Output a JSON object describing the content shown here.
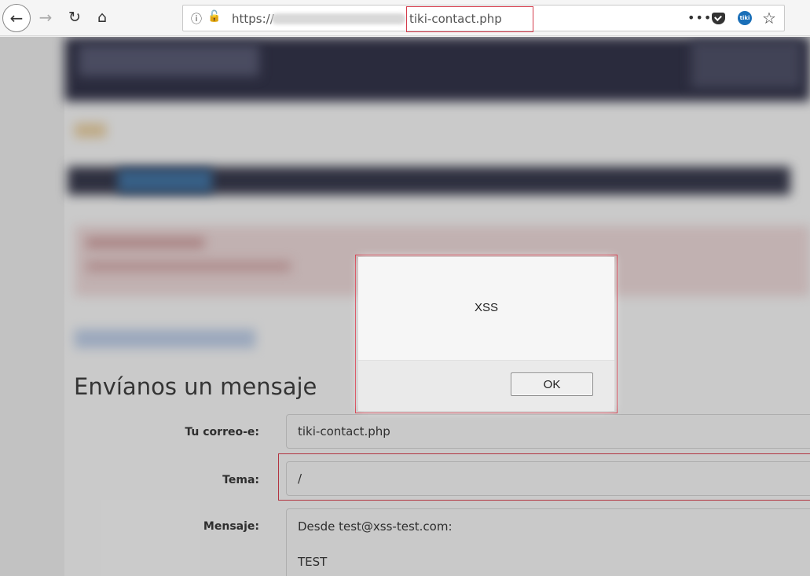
{
  "browser": {
    "back_icon": "arrow-left-icon",
    "forward_icon": "arrow-right-icon",
    "reload_icon": "reload-icon",
    "home_icon": "home-icon",
    "url_scheme": "https://",
    "url_path": "tiki-contact.php",
    "page_actions_label": "•••",
    "star_icon": "☆"
  },
  "form": {
    "title": "Envíanos un mensaje",
    "email_label": "Tu correo-e:",
    "email_value": "tiki-contact.php",
    "subject_label": "Tema:",
    "subject_value": "/",
    "message_label": "Mensaje:",
    "message_line1": "Desde test@xss-test.com:",
    "message_line2": "TEST"
  },
  "dialog": {
    "message": "XSS",
    "ok_label": "OK"
  },
  "colors": {
    "highlight": "#d43a4a",
    "header_dark": "#2e2f45",
    "nav_active": "#3e6f9e"
  }
}
